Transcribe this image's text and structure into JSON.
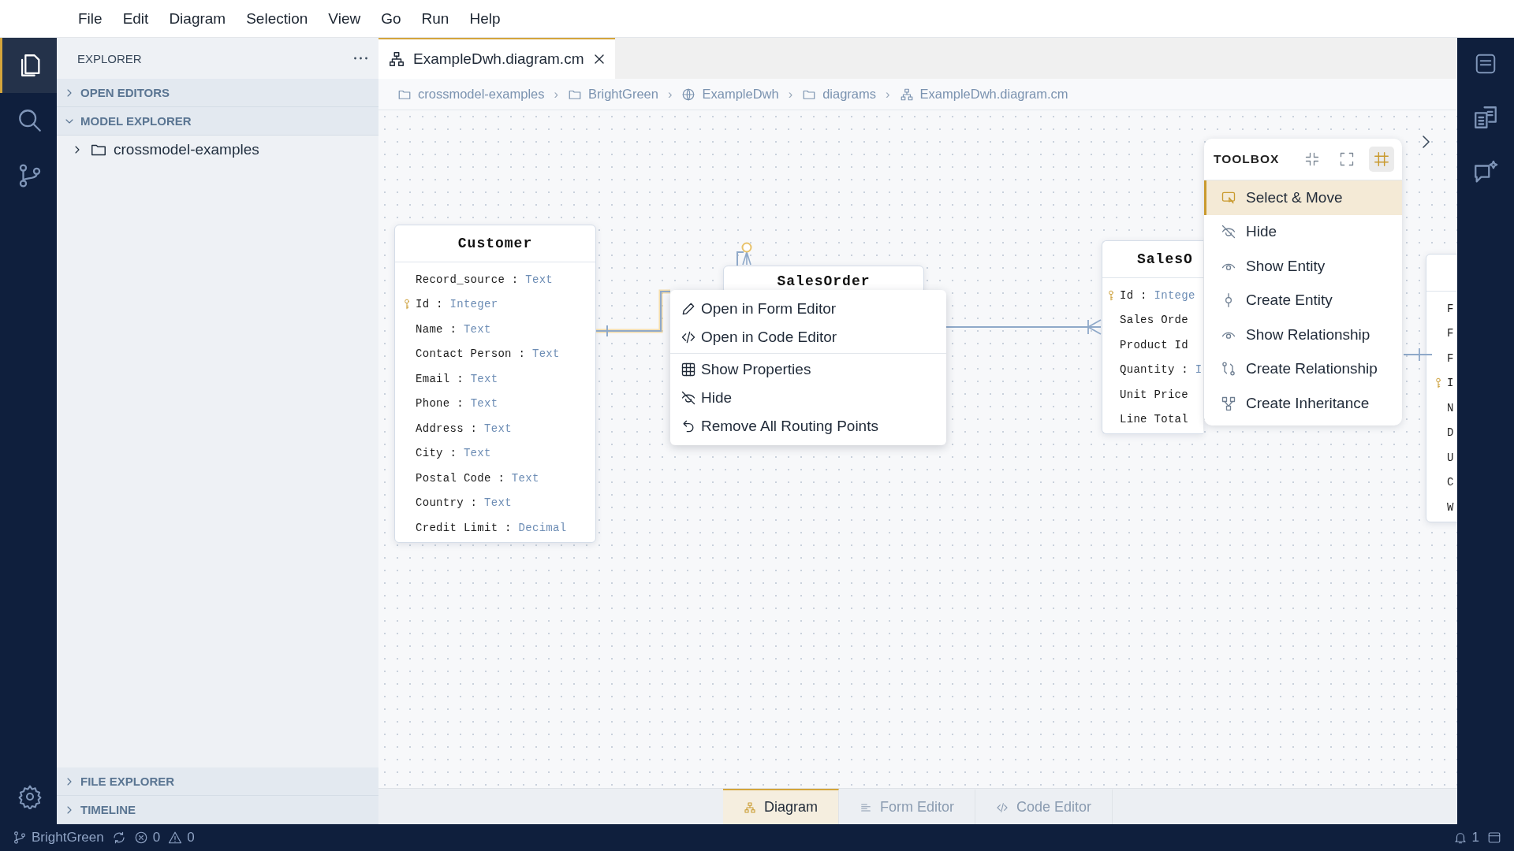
{
  "menu_bar": [
    "File",
    "Edit",
    "Diagram",
    "Selection",
    "View",
    "Go",
    "Run",
    "Help"
  ],
  "activity_bar": [
    {
      "kind": "files",
      "selected": true
    },
    {
      "kind": "search",
      "selected": false
    },
    {
      "kind": "source-control",
      "selected": false
    }
  ],
  "sidebar": {
    "title": "EXPLORER",
    "sections": [
      {
        "label": "OPEN EDITORS",
        "expanded": false
      },
      {
        "label": "MODEL EXPLORER",
        "expanded": true,
        "items": [
          {
            "label": "crossmodel-examples",
            "expanded": false
          }
        ]
      }
    ],
    "bottom_sections": [
      {
        "label": "FILE EXPLORER",
        "expanded": false
      },
      {
        "label": "TIMELINE",
        "expanded": false
      }
    ]
  },
  "editor_tabs": [
    {
      "label": "ExampleDwh.diagram.cm",
      "selected": true
    }
  ],
  "breadcrumbs": [
    {
      "kind": "folder",
      "label": "crossmodel-examples"
    },
    {
      "kind": "separator",
      "label": "›"
    },
    {
      "kind": "folder",
      "label": "BrightGreen"
    },
    {
      "kind": "separator",
      "label": "›"
    },
    {
      "kind": "globe",
      "label": "ExampleDwh"
    },
    {
      "kind": "separator",
      "label": "›"
    },
    {
      "kind": "folder",
      "label": "diagrams"
    },
    {
      "kind": "separator",
      "label": "›"
    },
    {
      "kind": "diagram",
      "label": "ExampleDwh.diagram.cm"
    }
  ],
  "diagram": {
    "entities": [
      {
        "name": "Customer",
        "attributes": [
          {
            "name": "Record_source",
            "sep": ":",
            "type": "Text",
            "key": false
          },
          {
            "name": "Id",
            "sep": ":",
            "type": "Integer",
            "key": true
          },
          {
            "name": "Name",
            "sep": ":",
            "type": "Text",
            "key": false
          },
          {
            "name": "Contact Person",
            "sep": ":",
            "type": "Text",
            "key": false
          },
          {
            "name": "Email",
            "sep": ":",
            "type": "Text",
            "key": false
          },
          {
            "name": "Phone",
            "sep": ":",
            "type": "Text",
            "key": false
          },
          {
            "name": "Address",
            "sep": ":",
            "type": "Text",
            "key": false
          },
          {
            "name": "City",
            "sep": ":",
            "type": "Text",
            "key": false
          },
          {
            "name": "Postal Code",
            "sep": ":",
            "type": "Text",
            "key": false
          },
          {
            "name": "Country",
            "sep": ":",
            "type": "Text",
            "key": false
          },
          {
            "name": "Credit Limit",
            "sep": ":",
            "type": "Decimal",
            "key": false
          }
        ]
      },
      {
        "name": "SalesOrder"
      },
      {
        "name": "SalesO",
        "attributes": [
          {
            "name": "Id",
            "sep": ":",
            "type": "Intege",
            "key": true
          },
          {
            "name": "Sales Orde",
            "key": false
          },
          {
            "name": "Product Id",
            "key": false
          },
          {
            "name": "Quantity",
            "sep": ":",
            "type": "I",
            "key": false
          },
          {
            "name": "Unit Price",
            "key": false
          },
          {
            "name": "Line Total",
            "key": false
          }
        ]
      },
      {
        "attributes": [
          {
            "name": "F",
            "key": false
          },
          {
            "name": "F",
            "key": false
          },
          {
            "name": "F",
            "key": false
          },
          {
            "name": "I",
            "key": true
          },
          {
            "name": "N",
            "key": false
          },
          {
            "name": "D",
            "key": false
          },
          {
            "name": "U",
            "key": false
          },
          {
            "name": "C",
            "key": false
          },
          {
            "name": "W",
            "key": false
          }
        ]
      }
    ],
    "context_menu": {
      "groups": [
        [
          {
            "kind": "pencil",
            "label": "Open in Form Editor"
          },
          {
            "kind": "code",
            "label": "Open in Code Editor"
          }
        ],
        [
          {
            "kind": "table",
            "label": "Show Properties"
          },
          {
            "kind": "hide",
            "label": "Hide"
          },
          {
            "kind": "undo",
            "label": "Remove All Routing Points"
          }
        ]
      ]
    },
    "toolbox": {
      "title": "TOOLBOX",
      "grid_on": true,
      "tools": [
        {
          "kind": "select",
          "label": "Select & Move",
          "selected": true
        },
        {
          "kind": "hide",
          "label": "Hide",
          "selected": false
        },
        {
          "kind": "eye",
          "label": "Show Entity",
          "selected": false
        },
        {
          "kind": "entity",
          "label": "Create Entity",
          "selected": false
        },
        {
          "kind": "eye",
          "label": "Show Relationship",
          "selected": false
        },
        {
          "kind": "relationship",
          "label": "Create Relationship",
          "selected": false
        },
        {
          "kind": "inheritance",
          "label": "Create Inheritance",
          "selected": false
        }
      ]
    }
  },
  "view_tabs": [
    {
      "kind": "diagram",
      "label": "Diagram",
      "selected": true
    },
    {
      "kind": "form",
      "label": "Form Editor",
      "selected": false
    },
    {
      "kind": "code",
      "label": "Code Editor",
      "selected": false
    }
  ],
  "status_bar": {
    "branch": "BrightGreen",
    "errors": "0",
    "warnings": "0",
    "notifications": "1"
  }
}
